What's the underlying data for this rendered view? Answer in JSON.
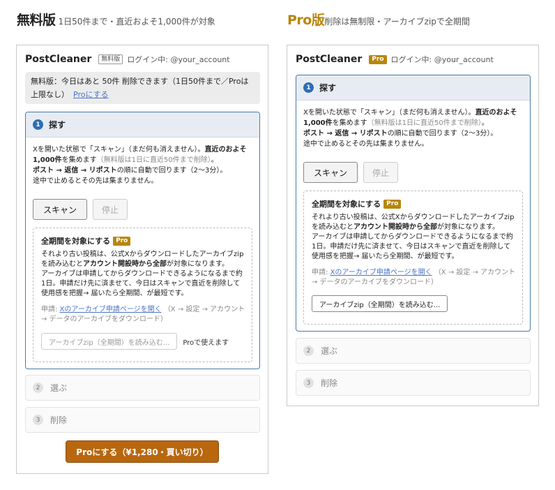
{
  "free": {
    "heading": "無料版",
    "subheading": "1日50件まで・直近およそ1,000件が対象",
    "app_name": "PostCleaner",
    "plan_badge": "無料版",
    "login": "ログイン中: @your_account",
    "notice_text": "無料版：今日はあと 50件 削除できます（1日50件まで／Proは上限なし）",
    "notice_link": "Proにする",
    "step1": {
      "num": "1",
      "title": "探す",
      "desc_a": "Xを開いた状態で「スキャン」（まだ何も消えません）。",
      "desc_b": "直近のおよそ1,000件",
      "desc_c": "を集めます",
      "desc_muted": "（無料版は1日に直近50件まで削除）",
      "desc_d": "。",
      "desc_e": "ポスト → 返信 → リポスト",
      "desc_f": "の順に自動で回ります（2〜3分）。",
      "desc_g": "途中で止めるとその先は集まりません。",
      "scan_label": "スキャン",
      "stop_label": "停止"
    },
    "archive": {
      "title": "全期間を対象にする",
      "pro_badge": "Pro",
      "desc_a": "それより古い投稿は、公式Xからダウンロードしたアーカイブzipを読み込むと",
      "desc_b": "アカウント開設時から全部",
      "desc_c": "が対象になります。",
      "desc_d": "アーカイブは申請してからダウンロードできるようになるまで約1日。申請だけ先に済ませて、今日はスキャンで直近を削除して使用感を把握",
      "desc_e": "→ 届いたら全期間、が最短です。",
      "apply_prefix": "申請:",
      "apply_link": "Xのアーカイブ申請ページを開く",
      "apply_suffix": "（X → 設定 → アカウント → データのアーカイブをダウンロード）",
      "zip_label": "アーカイブzip（全期間）を読み込む...",
      "pro_only": "Proで使えます"
    },
    "step2": {
      "num": "2",
      "label": "選ぶ"
    },
    "step3": {
      "num": "3",
      "label": "削除"
    },
    "buy_label": "Proにする（¥1,280・買い切り）"
  },
  "pro": {
    "heading": "Pro版",
    "subheading": "削除は無制限・アーカイブzipで全期間",
    "app_name": "PostCleaner",
    "plan_badge": "Pro",
    "login": "ログイン中: @your_account",
    "step1": {
      "num": "1",
      "title": "探す",
      "desc_a": "Xを開いた状態で「スキャン」（まだ何も消えません）。",
      "desc_b": "直近のおよそ1,000件",
      "desc_c": "を集めます",
      "desc_muted": "（無料版は1日に直近50件まで削除）",
      "desc_d": "。",
      "desc_e": "ポスト → 返信 → リポスト",
      "desc_f": "の順に自動で回ります（2〜3分）。",
      "desc_g": "途中で止めるとその先は集まりません。",
      "scan_label": "スキャン",
      "stop_label": "停止"
    },
    "archive": {
      "title": "全期間を対象にする",
      "pro_badge": "Pro",
      "desc_a": "それより古い投稿は、公式Xからダウンロードしたアーカイブzipを読み込むと",
      "desc_b": "アカウント開設時から全部",
      "desc_c": "が対象になります。",
      "desc_d": "アーカイブは申請してからダウンロードできるようになるまで約1日。申請だけ先に済ませて、今日はスキャンで直近を削除して使用感を把握",
      "desc_e": "→ 届いたら全期間、が最短です。",
      "apply_prefix": "申請:",
      "apply_link": "Xのアーカイブ申請ページを開く",
      "apply_suffix": "（X → 設定 → アカウント → データのアーカイブをダウンロード）",
      "zip_label": "アーカイブzip（全期間）を読み込む..."
    },
    "step2": {
      "num": "2",
      "label": "選ぶ"
    },
    "step3": {
      "num": "3",
      "label": "削除"
    }
  }
}
